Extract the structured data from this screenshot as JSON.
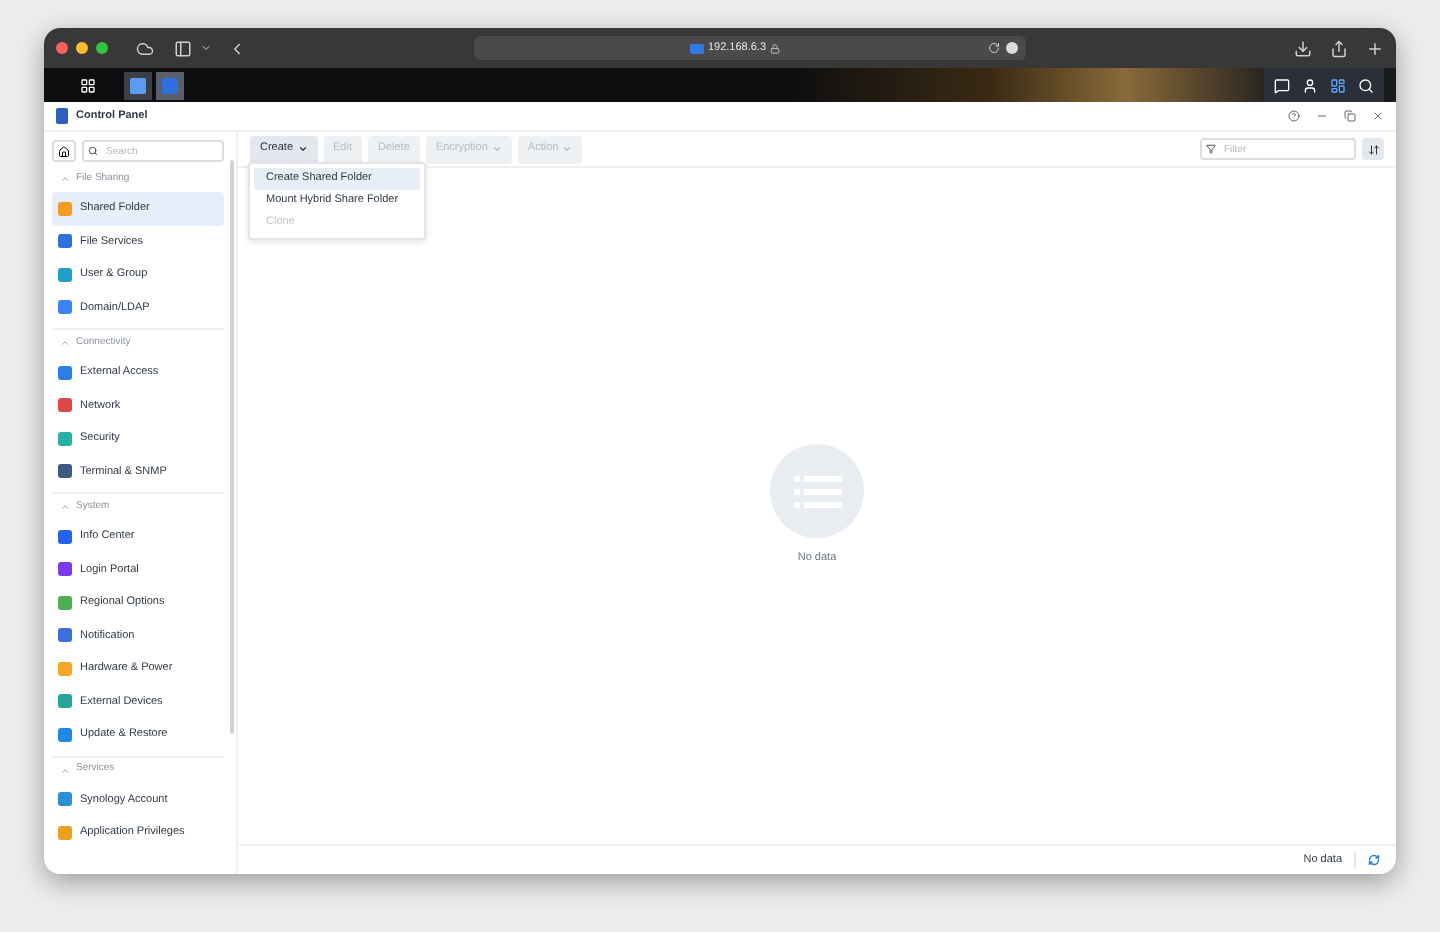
{
  "browser": {
    "url": "192.168.6.3"
  },
  "window": {
    "title": "Control Panel"
  },
  "sidebar": {
    "search": {
      "placeholder": "Search"
    },
    "sections": [
      {
        "title": "File Sharing",
        "expanded": true,
        "items": [
          {
            "label": "Shared Folder",
            "selected": true,
            "color": "#f59a23"
          },
          {
            "label": "File Services",
            "selected": false,
            "color": "#2f6fe0"
          },
          {
            "label": "User & Group",
            "selected": false,
            "color": "#1fa0c8"
          },
          {
            "label": "Domain/LDAP",
            "selected": false,
            "color": "#3b82f6"
          }
        ]
      },
      {
        "title": "Connectivity",
        "expanded": true,
        "items": [
          {
            "label": "External Access",
            "selected": false,
            "color": "#2b7de9"
          },
          {
            "label": "Network",
            "selected": false,
            "color": "#e04848"
          },
          {
            "label": "Security",
            "selected": false,
            "color": "#25b3a6"
          },
          {
            "label": "Terminal & SNMP",
            "selected": false,
            "color": "#3d5a80"
          }
        ]
      },
      {
        "title": "System",
        "expanded": true,
        "items": [
          {
            "label": "Info Center",
            "selected": false,
            "color": "#2563eb"
          },
          {
            "label": "Login Portal",
            "selected": false,
            "color": "#7c3aed"
          },
          {
            "label": "Regional Options",
            "selected": false,
            "color": "#4caf50"
          },
          {
            "label": "Notification",
            "selected": false,
            "color": "#3b6fe0"
          },
          {
            "label": "Hardware & Power",
            "selected": false,
            "color": "#f5a623"
          },
          {
            "label": "External Devices",
            "selected": false,
            "color": "#26a69a"
          },
          {
            "label": "Update & Restore",
            "selected": false,
            "color": "#1e88e5"
          }
        ]
      },
      {
        "title": "Services",
        "expanded": true,
        "items": [
          {
            "label": "Synology Account",
            "selected": false,
            "color": "#2b8fd6"
          },
          {
            "label": "Application Privileges",
            "selected": false,
            "color": "#f0a020"
          }
        ]
      }
    ]
  },
  "toolbar": {
    "buttons": [
      {
        "label": "Create",
        "disabled": false,
        "dropdown": true
      },
      {
        "label": "Edit",
        "disabled": true,
        "dropdown": false
      },
      {
        "label": "Delete",
        "disabled": true,
        "dropdown": false
      },
      {
        "label": "Encryption",
        "disabled": true,
        "dropdown": true
      },
      {
        "label": "Action",
        "disabled": true,
        "dropdown": true
      }
    ],
    "filter": {
      "placeholder": "Filter"
    }
  },
  "menu": {
    "items": [
      {
        "label": "Create Shared Folder",
        "selected": true,
        "disabled": false
      },
      {
        "label": "Mount Hybrid Share Folder",
        "selected": false,
        "disabled": false
      },
      {
        "label": "Clone",
        "selected": false,
        "disabled": true
      }
    ]
  },
  "empty_state": {
    "text": "No data"
  },
  "status_bar": {
    "text": "No data"
  }
}
